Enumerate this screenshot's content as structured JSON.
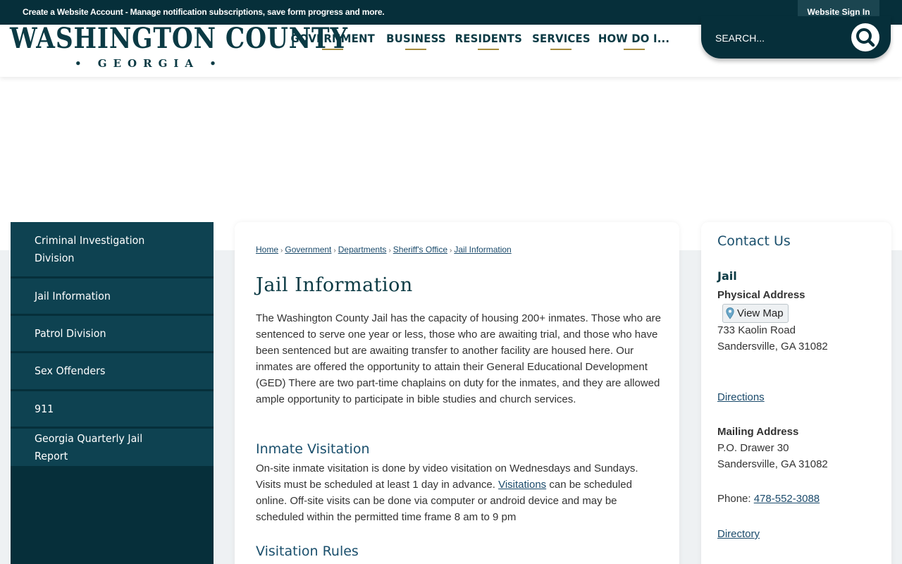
{
  "topbar": {
    "account_text": "Create a Website Account - Manage notification subscriptions, save form progress and more.",
    "signin_label": "Website Sign In"
  },
  "logo": {
    "line1": "WASHINGTON COUNTY",
    "line2": "• GEORGIA •"
  },
  "nav": {
    "items": [
      {
        "label": "GOVERNMENT"
      },
      {
        "label": "BUSINESS"
      },
      {
        "label": "RESIDENTS"
      },
      {
        "label": "SERVICES"
      },
      {
        "label": "HOW DO I..."
      }
    ]
  },
  "search": {
    "placeholder": "SEARCH...",
    "icon": "search-icon"
  },
  "sidebar": {
    "items": [
      {
        "label": "Criminal Investigation Division"
      },
      {
        "label": "Jail Information"
      },
      {
        "label": "Patrol Division"
      },
      {
        "label": "Sex Offenders"
      },
      {
        "label": "911"
      },
      {
        "label": "Georgia Quarterly Jail Report"
      }
    ]
  },
  "breadcrumb": {
    "items": [
      "Home",
      "Government",
      "Departments",
      "Sheriff's Office",
      "Jail Information"
    ],
    "separator": "›"
  },
  "main": {
    "title": "Jail Information",
    "intro": "The Washington County Jail has the capacity of housing 200+ inmates. Those who are sentenced to serve one year or less, those who are awaiting trial, and those who have been sentenced but are awaiting transfer to another facility are housed here. Our inmates are offered the opportunity to attain their General Educational Development (GED) There are two part-time chaplains on duty for the inmates, and they are allowed ample opportunity to participate in bible studies and church services.",
    "visitation_heading": "Inmate Visitation",
    "visitation_before": "On-site inmate visitation is done by video visitation on Wednesdays and Sundays. Visits must be scheduled at least 1 day in advance. ",
    "visitation_link": "Visitations",
    "visitation_after": " can be scheduled online. Off-site visits can be done via computer or android device and may be scheduled within the permitted time frame 8 am to 9 pm",
    "rules_heading": "Visitation Rules"
  },
  "contact": {
    "heading": "Contact Us",
    "name": "Jail",
    "physical_label": "Physical Address",
    "map_button": "View Map",
    "physical_line1": "733 Kaolin Road",
    "physical_line2": "Sandersville, GA 31082",
    "directions_link": "Directions",
    "mailing_label": "Mailing Address",
    "mailing_line1": "P.O. Drawer 30",
    "mailing_line2": "Sandersville, GA 31082",
    "phone_label": "Phone: ",
    "phone": "478-552-3088",
    "directory_link": "Directory"
  },
  "colors": {
    "dark_teal": "#062f3a",
    "sidebar_item": "#0e4251",
    "gold_accent": "#a58b3c",
    "heading_blue": "#1a4f6c",
    "link": "#1a4a6b"
  }
}
